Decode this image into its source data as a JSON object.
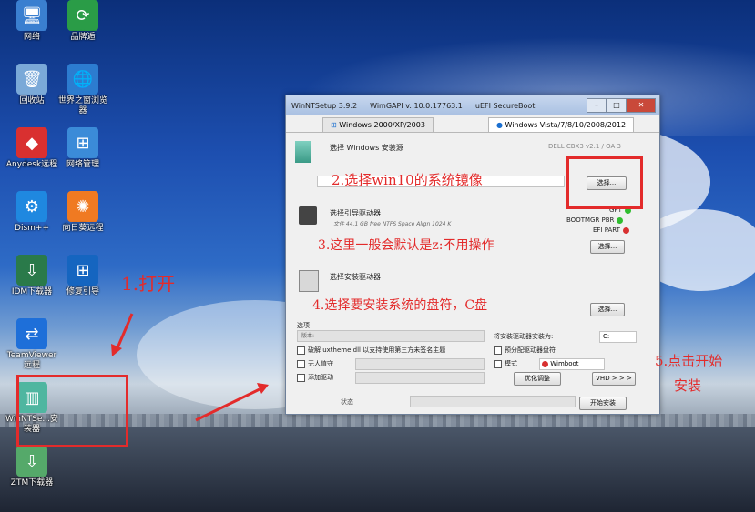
{
  "desktop": {
    "icons": [
      {
        "label": "网络",
        "icon": "network-icon",
        "color": "#3a7fd0",
        "glyph": "🖥"
      },
      {
        "label": "品牌逅",
        "icon": "brand-icon",
        "color": "#2a9c47",
        "glyph": "⟳"
      },
      {
        "label": "回收站",
        "icon": "recycle-bin-icon",
        "color": "#7aa9d8",
        "glyph": "🗑"
      },
      {
        "label": "世界之窗浏览器",
        "icon": "globe-browser-icon",
        "color": "#2c7cd0",
        "glyph": "🌐"
      },
      {
        "label": "Anydesk远程",
        "icon": "anydesk-icon",
        "color": "#d93030",
        "glyph": "◆"
      },
      {
        "label": "网络管理",
        "icon": "network-manager-icon",
        "color": "#3b8bd8",
        "glyph": "⊞"
      },
      {
        "label": "Dism++",
        "icon": "dism-icon",
        "color": "#1f88e0",
        "glyph": "⚙"
      },
      {
        "label": "向日葵远程",
        "icon": "sunflower-icon",
        "color": "#f07a22",
        "glyph": "✺"
      },
      {
        "label": "IDM下载器",
        "icon": "idm-icon",
        "color": "#2a7a4a",
        "glyph": "⇩"
      },
      {
        "label": "修复引导",
        "icon": "windows-icon",
        "color": "#1565c0",
        "glyph": "⊞"
      },
      {
        "label": "TeamViewer远程",
        "icon": "teamviewer-icon",
        "color": "#1e6fd9",
        "glyph": "⇄"
      },
      {
        "label": "WinNTSe...安装器",
        "icon": "winntsetup-icon",
        "color": "#4fb6a0",
        "glyph": "▥"
      },
      {
        "label": "ZTM下载器",
        "icon": "download-icon",
        "color": "#55a96a",
        "glyph": "⇩"
      }
    ]
  },
  "window": {
    "title": "WinNTSetup 3.9.2",
    "api": "WimGAPI v. 10.0.17763.1",
    "boot": "uEFI SecureBoot",
    "tabs": [
      "Windows 2000/XP/2003",
      "Windows Vista/7/8/10/2008/2012"
    ],
    "source_label": "选择 Windows 安装源",
    "device_info": "DELL CBX3 v2.1 / OA 3",
    "select_label": "选择...",
    "boot_drive_label": "选择引导驱动器",
    "boot_drive_info": "文件 44.1 GB free NTFS Space Align 1024 K",
    "status_gpt": "GPT",
    "status_bootmgr": "BOOTMGR PBR",
    "status_efi": "EFI PART",
    "install_drive_label": "选择安装驱动器",
    "options_label": "选项",
    "version_field": "版本:",
    "mount_label": "将安装驱动器安装为:",
    "drive_letter": "C:",
    "opt_uxtheme": "破解 uxtheme.dll 以支持使用第三方未签名主题",
    "opt_unattend": "无人值守",
    "opt_driver": "添加驱动",
    "opt_prealloc": "预分配驱动器盘符",
    "opt_mode": "模式",
    "opt_wimboot": "Wimboot",
    "tweak_btn": "优化调整",
    "vhd_btn": "VHD > > >",
    "status_label": "状态",
    "start_btn": "开始安装"
  },
  "annotations": {
    "step1": "1.打开",
    "step2": "2.选择win10的系统镜像",
    "step3": "3.这里一般会默认是z:不用操作",
    "step4": "4.选择要安装系统的盘符，C盘",
    "step5a": "5.点击开始",
    "step5b": "安装",
    "color": "#e32b2b"
  }
}
